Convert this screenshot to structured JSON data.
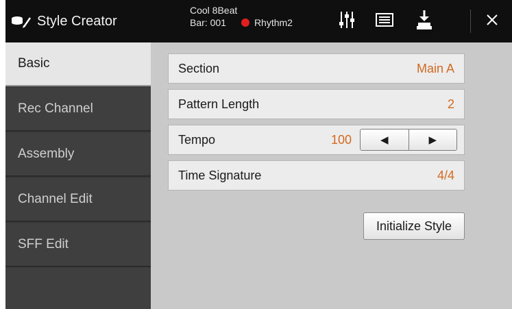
{
  "header": {
    "app_title": "Style Creator",
    "style_name": "Cool 8Beat",
    "bar_label": "Bar: 001",
    "channel_name": "Rhythm2",
    "icons": [
      "style-creator-icon",
      "mixer-icon",
      "list-icon",
      "save-icon",
      "close-icon"
    ]
  },
  "sidebar": {
    "tabs": [
      {
        "label": "Basic",
        "active": true
      },
      {
        "label": "Rec Channel",
        "active": false
      },
      {
        "label": "Assembly",
        "active": false
      },
      {
        "label": "Channel Edit",
        "active": false
      },
      {
        "label": "SFF Edit",
        "active": false
      }
    ]
  },
  "main": {
    "section": {
      "label": "Section",
      "value": "Main A"
    },
    "pattern_length": {
      "label": "Pattern Length",
      "value": "2"
    },
    "tempo": {
      "label": "Tempo",
      "value": "100"
    },
    "time_signature": {
      "label": "Time Signature",
      "value": "4/4"
    },
    "initialize_button": "Initialize Style"
  },
  "colors": {
    "accent_value": "#d2691e",
    "record_dot": "#e02020",
    "header_bg": "#0f0f0f",
    "sidebar_bg": "#3f3f3f"
  }
}
